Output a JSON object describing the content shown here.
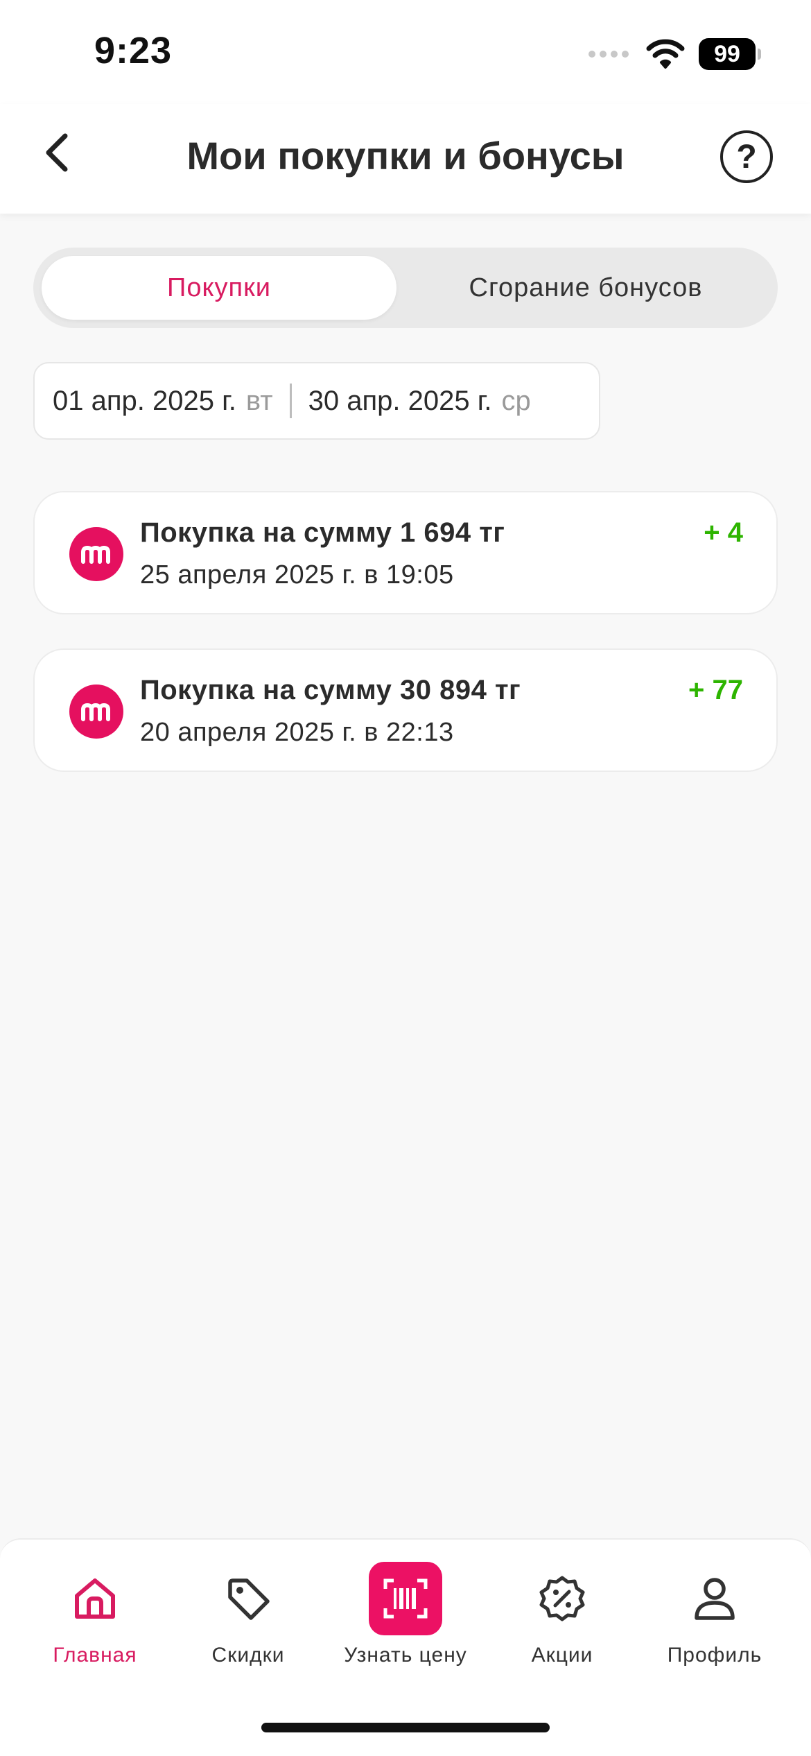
{
  "status_bar": {
    "time": "9:23",
    "battery": "99"
  },
  "header": {
    "title": "Мои покупки и бонусы",
    "help_symbol": "?"
  },
  "tabs": [
    {
      "label": "Покупки",
      "active": true
    },
    {
      "label": "Сгорание бонусов",
      "active": false
    }
  ],
  "date_range": {
    "start": "01 апр. 2025 г.",
    "start_weekday": "вт",
    "end": "30 апр. 2025 г.",
    "end_weekday": "ср"
  },
  "purchases": [
    {
      "title": "Покупка на сумму 1 694 тг",
      "date": "25 апреля 2025 г. в 19:05",
      "bonus": "+ 4"
    },
    {
      "title": "Покупка на сумму 30 894 тг",
      "date": "20 апреля 2025 г. в 22:13",
      "bonus": "+ 77"
    }
  ],
  "nav": [
    {
      "label": "Главная",
      "icon": "home-icon",
      "active": true
    },
    {
      "label": "Скидки",
      "icon": "tag-icon",
      "active": false
    },
    {
      "label": "Узнать цену",
      "icon": "barcode-scan-icon",
      "active": false
    },
    {
      "label": "Акции",
      "icon": "percent-badge-icon",
      "active": false
    },
    {
      "label": "Профиль",
      "icon": "profile-icon",
      "active": false
    }
  ],
  "colors": {
    "accent": "#e5105f",
    "bonus_green": "#2db400",
    "background": "#f8f8f8"
  }
}
